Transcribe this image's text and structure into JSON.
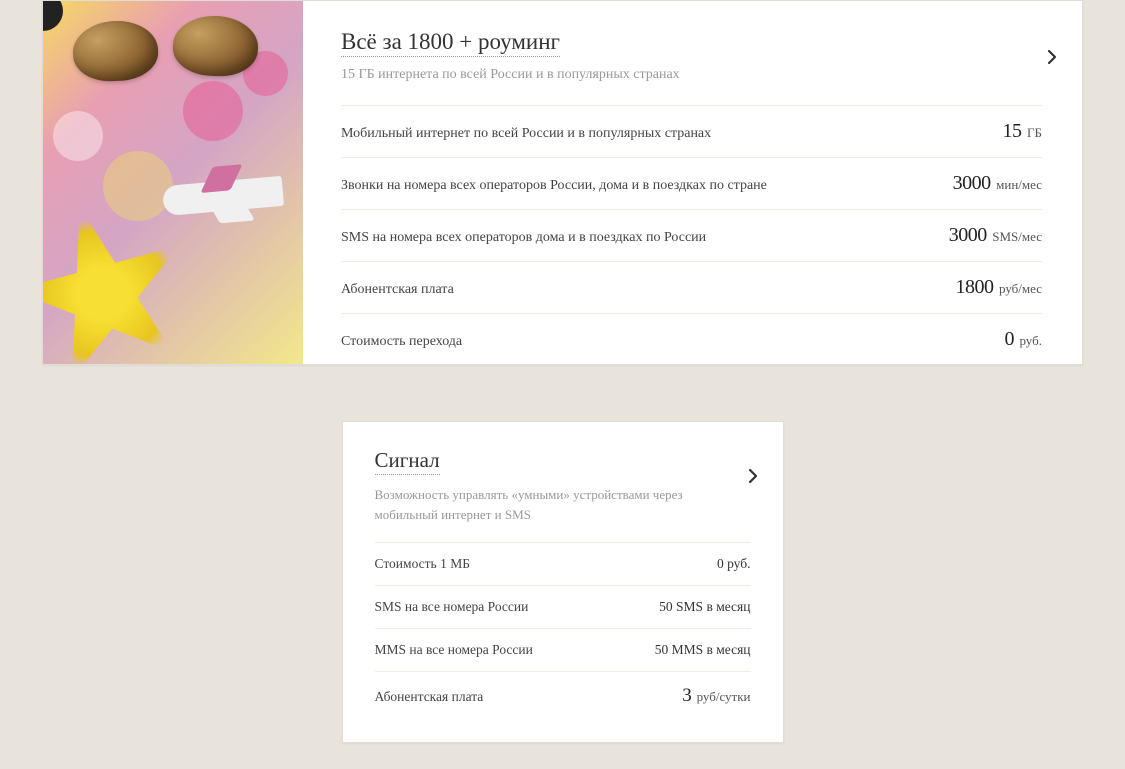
{
  "tariff1": {
    "title": "Всё за 1800 + роуминг",
    "subtitle": "15 ГБ интернета по всей России и в популярных странах",
    "rows": [
      {
        "label": "Мобильный интернет по всей России и в популярных странах",
        "num": "15",
        "unit": "ГБ"
      },
      {
        "label": "Звонки на номера всех операторов России, дома и в поездках по стране",
        "num": "3000",
        "unit": "мин/мес"
      },
      {
        "label": "SMS на номера всех операторов дома и в поездках по России",
        "num": "3000",
        "unit": "SMS/мес"
      },
      {
        "label": "Абонентская плата",
        "num": "1800",
        "unit": "руб/мес"
      },
      {
        "label": "Стоимость перехода",
        "num": "0",
        "unit": "руб."
      }
    ]
  },
  "tariff2": {
    "title": "Сигнал",
    "subtitle": "Возможность управлять «умными» устройствами через мобильный интернет и SMS",
    "rows": [
      {
        "label": "Стоимость 1 МБ",
        "plain": "0 руб."
      },
      {
        "label": "SMS на все номера России",
        "plain": "50 SMS в месяц"
      },
      {
        "label": "MMS на все номера России",
        "plain": "50 MMS в месяц"
      },
      {
        "label": "Абонентская плата",
        "num": "3",
        "unit": "руб/сутки"
      }
    ]
  }
}
